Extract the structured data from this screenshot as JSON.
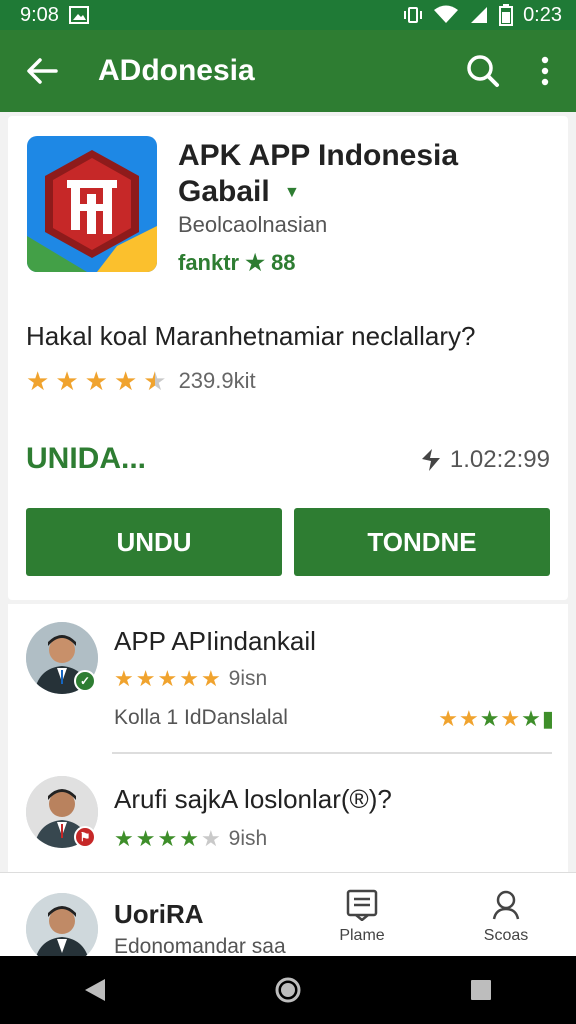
{
  "status_bar": {
    "time_left": "9:08",
    "time_right": "0:23"
  },
  "app_bar": {
    "title": "ADdonesia"
  },
  "app": {
    "name": "APK APP Indonesia Gabail",
    "developer": "Beolcaolnasian",
    "rating_tag": "fanktr ★ 88",
    "question": "Hakal koal Maranhetnamiar neclallary?",
    "rating": 4.5,
    "rating_count": "239.9kit",
    "install_status": "UNIDA...",
    "size": "1.02:2:99",
    "button_left": "UNDU",
    "button_right": "TONDNE"
  },
  "list_items": [
    {
      "title": "APP APIindankail",
      "meta": "9isn",
      "sub": "Kolla 1 IdDanslalal"
    },
    {
      "title": "Arufi sajkA loslonlar(®)?",
      "meta": "9ish"
    }
  ],
  "bottom_bar": {
    "title": "UoriRA",
    "subtitle": "Edonomandar saa",
    "nav": [
      {
        "label": "Plame",
        "icon": "document-icon"
      },
      {
        "label": "Scoas",
        "icon": "person-icon"
      }
    ]
  }
}
